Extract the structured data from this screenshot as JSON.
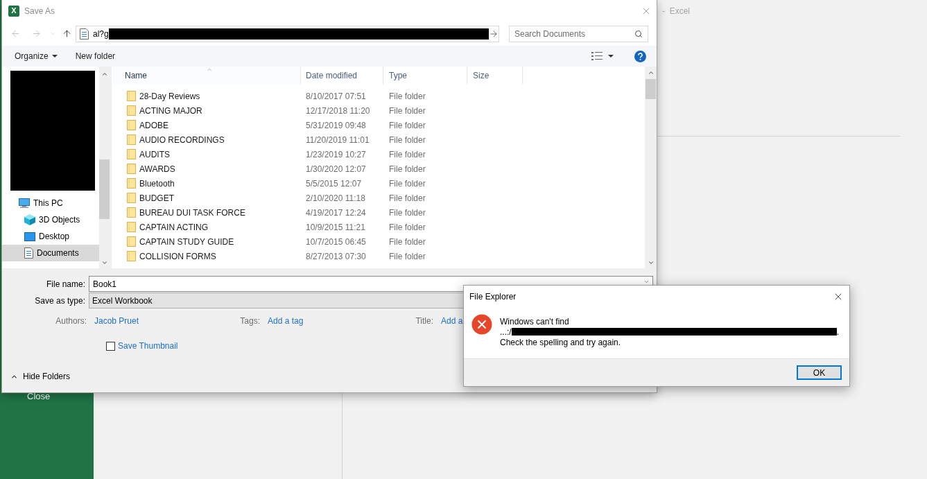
{
  "excel_window": {
    "title": "-  Excel",
    "sidebar_items": [
      {
        "label": "Close"
      }
    ]
  },
  "save_dialog": {
    "app_icon": {
      "letter": "X"
    },
    "title": "Save As",
    "nav_buttons": [
      {
        "kind": "back",
        "disabled": true
      },
      {
        "kind": "forward",
        "disabled": true
      },
      {
        "kind": "recent",
        "disabled": true
      },
      {
        "kind": "up",
        "disabled": false
      }
    ],
    "address_bar": {
      "value": "al?g"
    },
    "search": {
      "placeholder": "Search Documents"
    },
    "toolbar": [
      {
        "label": "Organize",
        "kind": "menu"
      },
      {
        "label": "New folder",
        "kind": "plain"
      }
    ],
    "navigation": [
      {
        "label": "This PC",
        "kind": "pc",
        "selected": false,
        "children": [
          {
            "label": "3D Objects",
            "kind": "objects3d",
            "selected": false
          },
          {
            "label": "Desktop",
            "kind": "desktop",
            "selected": false
          },
          {
            "label": "Documents",
            "kind": "documents",
            "selected": true
          }
        ]
      }
    ],
    "file_list": {
      "columns": [
        {
          "label": "Name",
          "sorted": true
        },
        {
          "label": "Date modified",
          "sorted": false
        },
        {
          "label": "Type",
          "sorted": false
        },
        {
          "label": "Size",
          "sorted": false
        }
      ],
      "rows": [
        {
          "name": "28-Day Reviews",
          "date_modified": "8/10/2017 07:51",
          "type": "File folder"
        },
        {
          "name": "ACTING MAJOR",
          "date_modified": "12/17/2018 11:20",
          "type": "File folder"
        },
        {
          "name": "ADOBE",
          "date_modified": "5/31/2019 09:48",
          "type": "File folder"
        },
        {
          "name": "AUDIO RECORDINGS",
          "date_modified": "11/20/2019 11:01",
          "type": "File folder"
        },
        {
          "name": "AUDITS",
          "date_modified": "1/23/2019 10:27",
          "type": "File folder"
        },
        {
          "name": "AWARDS",
          "date_modified": "1/30/2020 12:07",
          "type": "File folder"
        },
        {
          "name": "Bluetooth",
          "date_modified": "5/5/2015 12:07",
          "type": "File folder"
        },
        {
          "name": "BUDGET",
          "date_modified": "2/10/2020 11:18",
          "type": "File folder"
        },
        {
          "name": "BUREAU DUI TASK FORCE",
          "date_modified": "4/19/2017 12:24",
          "type": "File folder"
        },
        {
          "name": "CAPTAIN ACTING",
          "date_modified": "10/9/2015 11:21",
          "type": "File folder"
        },
        {
          "name": "CAPTAIN STUDY GUIDE",
          "date_modified": "10/7/2015 06:45",
          "type": "File folder"
        },
        {
          "name": "COLLISION FORMS",
          "date_modified": "8/27/2013 07:30",
          "type": "File folder"
        }
      ]
    },
    "file_name": {
      "label": "File name:",
      "value": "Book1"
    },
    "save_as_type": {
      "label": "Save as type:",
      "value": "Excel Workbook"
    },
    "properties": [
      {
        "label": "Authors:",
        "value": "Jacob Pruet"
      },
      {
        "label": "Tags:",
        "value": "Add a tag"
      },
      {
        "label": "Title:",
        "value": "Add a"
      }
    ],
    "save_thumbnail": {
      "label": "Save Thumbnail",
      "checked": false
    },
    "hide_folders": {
      "label": "Hide Folders"
    }
  },
  "error_dialog": {
    "title": "File Explorer",
    "message": {
      "line_1": "Windows can't find",
      "path_prefix": "...:/",
      "path_suffix": ".",
      "line_3": "Check the spelling and try again."
    },
    "buttons": [
      {
        "label": "OK",
        "default": true
      }
    ]
  }
}
